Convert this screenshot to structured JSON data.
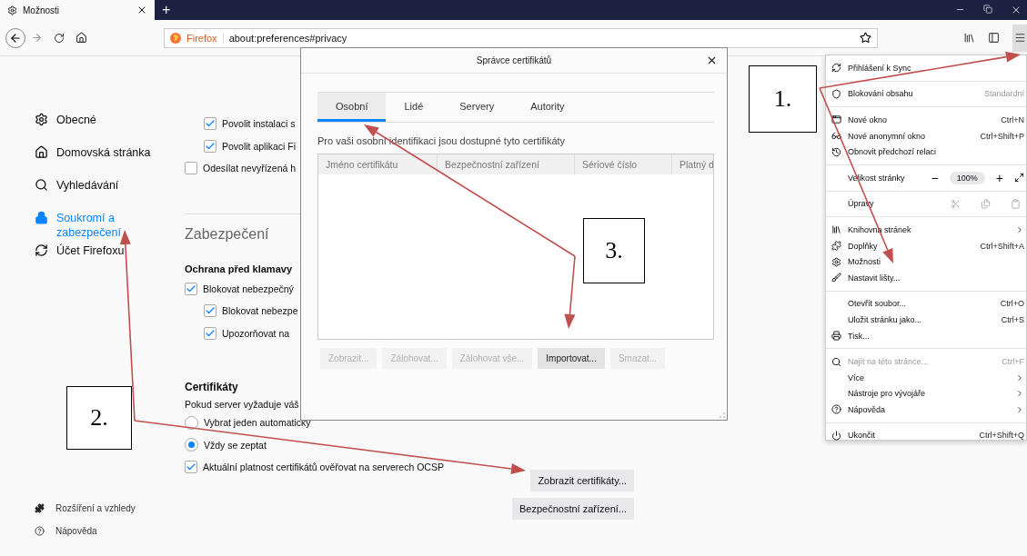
{
  "tab_strip": {
    "tabs": [
      {
        "title": "Možnosti",
        "selected": true
      }
    ],
    "new_tab": "+"
  },
  "toolbar": {
    "identity": "Firefox",
    "url": "about:preferences#privacy"
  },
  "sidebar": {
    "items": [
      {
        "label": "Obecné",
        "selected": false
      },
      {
        "label": "Domovská stránka",
        "selected": false
      },
      {
        "label": "Vyhledávání",
        "selected": false
      },
      {
        "label": "Soukromí a\nzabezpečení",
        "selected": true
      },
      {
        "label": "Účet Firefoxu",
        "selected": false
      }
    ],
    "footer": [
      {
        "label": "Rozšíření a vzhledy"
      },
      {
        "label": "Nápověda"
      }
    ]
  },
  "content": {
    "options": [
      {
        "kind": "group",
        "children": [
          {
            "label": "Povolit instalaci s",
            "checked": true
          },
          {
            "label": "Povolit aplikaci Fi",
            "checked": true
          }
        ]
      },
      {
        "kind": "checkbox",
        "label": "Odesílat nevyřízená h",
        "checked": false
      }
    ],
    "security": {
      "heading": "Zabezpečení",
      "subheading": "Ochrana před klamavy",
      "options": [
        {
          "kind": "checkbox",
          "label": "Blokovat nebezpečný",
          "checked": true,
          "children": [
            {
              "label": "Blokovat nebezpe",
              "checked": true
            },
            {
              "label": "Upozorňovat na",
              "checked": true
            }
          ]
        }
      ]
    },
    "certificates": {
      "heading": "Certifikáty",
      "text": "Pokud server vyžaduje váš",
      "radios": [
        {
          "label": "Vybrat jeden automaticky",
          "selected": false
        },
        {
          "label": "Vždy se zeptat",
          "selected": true
        }
      ],
      "ocsp": {
        "label": "Aktuální platnost certifikátů ověřovat na serverech OCSP",
        "checked": true
      },
      "buttons": [
        "Zobrazit certifikáty...",
        "Bezpečnostní zařízení..."
      ]
    }
  },
  "dialog": {
    "title": "Správce certifikátů",
    "tabs": [
      {
        "label": "Osobní",
        "selected": true
      },
      {
        "label": "Lidé",
        "selected": false
      },
      {
        "label": "Servery",
        "selected": false
      },
      {
        "label": "Autority",
        "selected": false
      }
    ],
    "description": "Pro vaši osobní identifikaci jsou dostupné tyto certifikáty",
    "table": {
      "columns": [
        "Jméno certifikátu",
        "Bezpečnostní zařízení",
        "Sériové číslo",
        "Platný d"
      ]
    },
    "buttons": [
      {
        "label": "Zobrazit...",
        "disabled": true
      },
      {
        "label": "Zálohovat...",
        "disabled": true
      },
      {
        "label": "Zálohovat vše...",
        "disabled": true
      },
      {
        "label": "Importovat...",
        "disabled": false
      },
      {
        "label": "Smazat...",
        "disabled": true
      }
    ]
  },
  "menu": {
    "sections": [
      {
        "items": [
          {
            "kind": "item",
            "label": "Přihlášení k Sync",
            "disabled": false,
            "submenu": false
          }
        ]
      },
      {
        "items": [
          {
            "kind": "item",
            "label": "Blokování obsahu",
            "value": "Standardní",
            "disabled": false,
            "submenu": false
          }
        ]
      },
      {
        "items": [
          {
            "kind": "item",
            "label": "Nové okno",
            "shortcut": "Ctrl+N",
            "disabled": false,
            "submenu": false
          },
          {
            "kind": "item",
            "label": "Nové anonymní okno",
            "shortcut": "Ctrl+Shift+P",
            "disabled": false,
            "submenu": false
          },
          {
            "kind": "item",
            "label": "Obnovit předchozí relaci",
            "disabled": false,
            "submenu": false
          }
        ]
      },
      {
        "items": [
          {
            "kind": "zoom",
            "label": "Velikost stránky",
            "minus": "−",
            "zoom": "100%",
            "plus": "+"
          }
        ]
      },
      {
        "items": [
          {
            "kind": "edit",
            "label": "Úpravy",
            "disabled": true
          }
        ]
      },
      {
        "items": [
          {
            "kind": "item",
            "label": "Knihovna stránek",
            "disabled": false,
            "submenu": true
          },
          {
            "kind": "item",
            "label": "Doplňky",
            "shortcut": "Ctrl+Shift+A",
            "disabled": false,
            "submenu": false
          },
          {
            "kind": "item",
            "label": "Možnosti",
            "disabled": false,
            "submenu": false
          },
          {
            "kind": "item",
            "label": "Nastavit lišty...",
            "disabled": false,
            "submenu": false
          }
        ]
      },
      {
        "items": [
          {
            "kind": "item",
            "label": "Otevřít soubor...",
            "shortcut": "Ctrl+O",
            "disabled": false,
            "submenu": false
          },
          {
            "kind": "item",
            "label": "Uložit stránku jako...",
            "shortcut": "Ctrl+S",
            "disabled": false,
            "submenu": false
          },
          {
            "kind": "item",
            "label": "Tisk...",
            "disabled": false,
            "submenu": false
          }
        ]
      },
      {
        "items": [
          {
            "kind": "item",
            "label": "Najít na této stránce...",
            "shortcut": "Ctrl+F",
            "disabled": true,
            "submenu": false
          },
          {
            "kind": "item",
            "label": "Více",
            "disabled": false,
            "submenu": true
          },
          {
            "kind": "item",
            "label": "Nástroje pro vývojáře",
            "disabled": false,
            "submenu": true
          },
          {
            "kind": "item",
            "label": "Nápověda",
            "disabled": false,
            "submenu": true
          }
        ]
      },
      {
        "items": [
          {
            "kind": "item",
            "label": "Ukončit",
            "shortcut": "Ctrl+Shift+Q",
            "disabled": false,
            "submenu": false
          }
        ]
      }
    ]
  },
  "annotations": [
    {
      "label": "1."
    },
    {
      "label": "2."
    },
    {
      "label": "3."
    }
  ]
}
